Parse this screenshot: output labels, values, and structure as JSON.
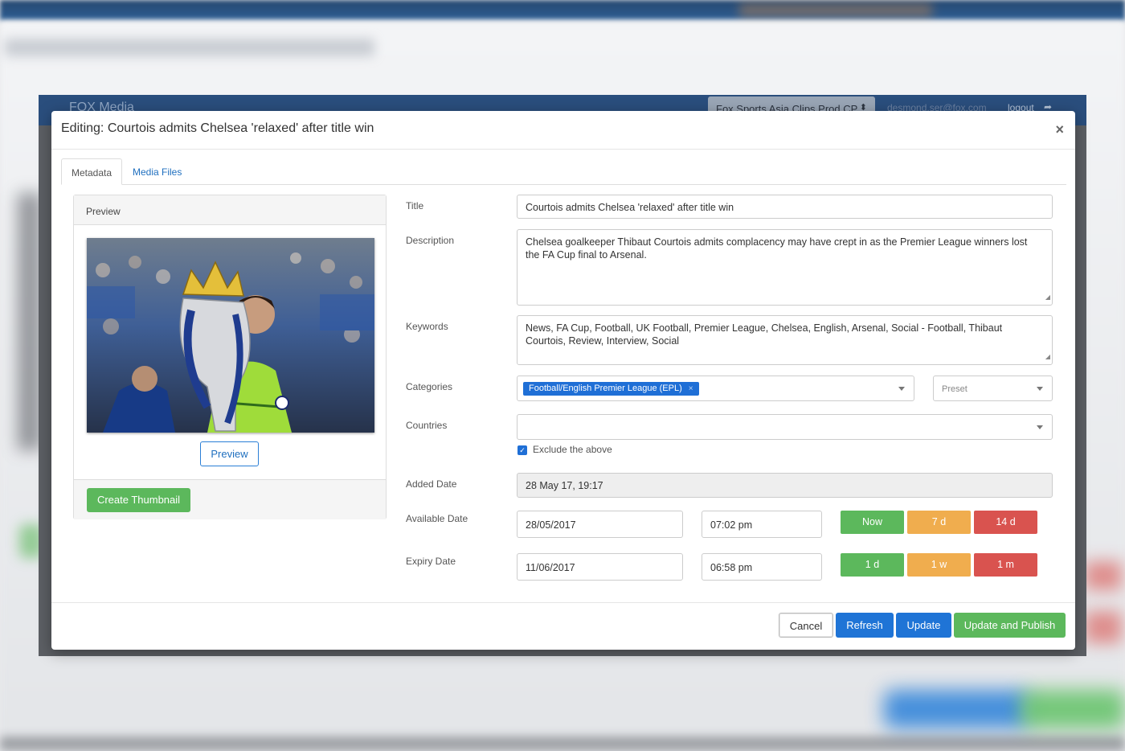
{
  "app": {
    "logo": "FOX Media",
    "account_select": "Fox Sports Asia Clips Prod CP",
    "user_email": "desmond.ser@fox.com",
    "logout_label": "logout"
  },
  "modal": {
    "title": "Editing: Courtois admits Chelsea 'relaxed' after title win",
    "close_symbol": "×"
  },
  "tabs": [
    {
      "label": "Metadata",
      "active": true
    },
    {
      "label": "Media Files",
      "active": false
    }
  ],
  "preview_panel": {
    "heading": "Preview",
    "preview_button": "Preview",
    "create_thumbnail_button": "Create Thumbnail"
  },
  "form": {
    "title_label": "Title",
    "title_value": "Courtois admits Chelsea 'relaxed' after title win",
    "description_label": "Description",
    "description_value": "Chelsea goalkeeper Thibaut Courtois admits complacency may have crept in as the Premier League winners lost the FA Cup final to Arsenal.",
    "keywords_label": "Keywords",
    "keywords_value": "News, FA Cup, Football, UK Football, Premier League, Chelsea, English, Arsenal, Social - Football, Thibaut Courtois, Review, Interview, Social",
    "categories_label": "Categories",
    "category_tag": "Football/English Premier League (EPL)",
    "category_tag_remove": "×",
    "preset_placeholder": "Preset",
    "countries_label": "Countries",
    "exclude_label": "Exclude the above",
    "exclude_checked": true,
    "added_date_label": "Added Date",
    "added_date_value": "28 May 17, 19:17",
    "available_date_label": "Available Date",
    "available_date": "28/05/2017",
    "available_time": "07:02 pm",
    "available_buttons": [
      "Now",
      "7 d",
      "14 d"
    ],
    "expiry_date_label": "Expiry Date",
    "expiry_date": "11/06/2017",
    "expiry_time": "06:58 pm",
    "expiry_buttons": [
      "1 d",
      "1 w",
      "1 m"
    ]
  },
  "footer": {
    "cancel": "Cancel",
    "refresh": "Refresh",
    "update": "Update",
    "update_publish": "Update and Publish"
  },
  "colors": {
    "primary": "#1f74d6",
    "success": "#5cb85c",
    "warning": "#f0ad4e",
    "danger": "#d9534f",
    "nav": "#2a4e7d"
  }
}
